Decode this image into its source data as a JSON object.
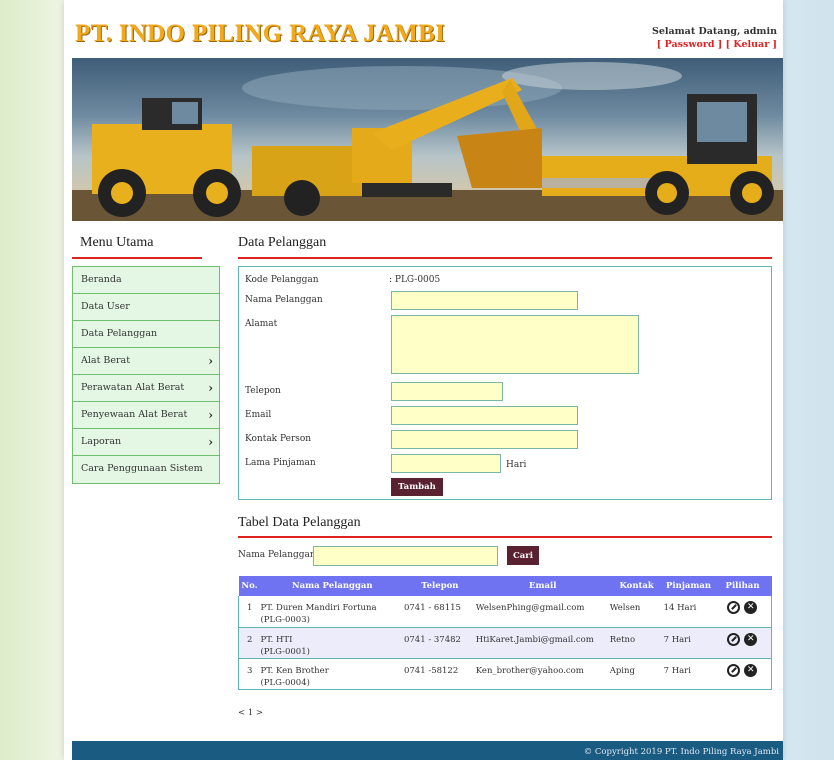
{
  "header": {
    "brand": "PT. INDO PILING RAYA JAMBI",
    "welcome": "Selamat Datang, admin",
    "password_link": "[ Password ]",
    "logout_link": "[ Keluar ]"
  },
  "sidebar": {
    "title": "Menu Utama",
    "items": [
      {
        "label": "Beranda"
      },
      {
        "label": "Data User"
      },
      {
        "label": "Data Pelanggan"
      },
      {
        "label": "Alat Berat"
      },
      {
        "label": "Perawatan Alat Berat"
      },
      {
        "label": "Penyewaan Alat Berat"
      },
      {
        "label": "Laporan"
      },
      {
        "label": "Cara Penggunaan Sistem"
      }
    ]
  },
  "form": {
    "title": "Data Pelanggan",
    "kode_label": "Kode Pelanggan",
    "kode_value": ": PLG-0005",
    "nama_label": "Nama Pelanggan",
    "alamat_label": "Alamat",
    "telepon_label": "Telepon",
    "email_label": "Email",
    "kontak_label": "Kontak Person",
    "lama_label": "Lama Pinjaman",
    "lama_unit": "Hari",
    "submit_label": "Tambah"
  },
  "table_section": {
    "title": "Tabel Data Pelanggan",
    "search_label": "Nama Pelanggan :",
    "search_button": "Cari",
    "columns": [
      "No.",
      "Nama Pelanggan",
      "Telepon",
      "Email",
      "Kontak",
      "Pinjaman",
      "Pilihan"
    ],
    "rows": [
      {
        "no": "1",
        "nama": "PT. Duren Mandiri Fortuna",
        "kode": "(PLG-0003)",
        "telepon": "0741 - 68115",
        "email": "WelsenPhing@gmail.com",
        "kontak": "Welsen",
        "pinjaman": "14 Hari"
      },
      {
        "no": "2",
        "nama": "PT. HTI",
        "kode": "(PLG-0001)",
        "telepon": "0741 - 37482",
        "email": "HtiKaret.Jambi@gmail.com",
        "kontak": "Retno",
        "pinjaman": "7 Hari"
      },
      {
        "no": "3",
        "nama": "PT. Ken Brother",
        "kode": "(PLG-0004)",
        "telepon": "0741 -58122",
        "email": "Ken_brother@yahoo.com",
        "kontak": "Aping",
        "pinjaman": "7 Hari"
      }
    ],
    "pager": "< 1 >"
  },
  "footer": {
    "copyright": "© Copyright 2019 PT. Indo Piling Raya Jambi"
  },
  "colors": {
    "brand": "#f2a91b",
    "accent_rule": "#dd2222",
    "menu_bg": "#e4f7e4",
    "input_bg": "#ffffc8",
    "button_bg": "#5a2130",
    "table_header": "#6f73f1",
    "footer_bg": "#1a5b82"
  }
}
